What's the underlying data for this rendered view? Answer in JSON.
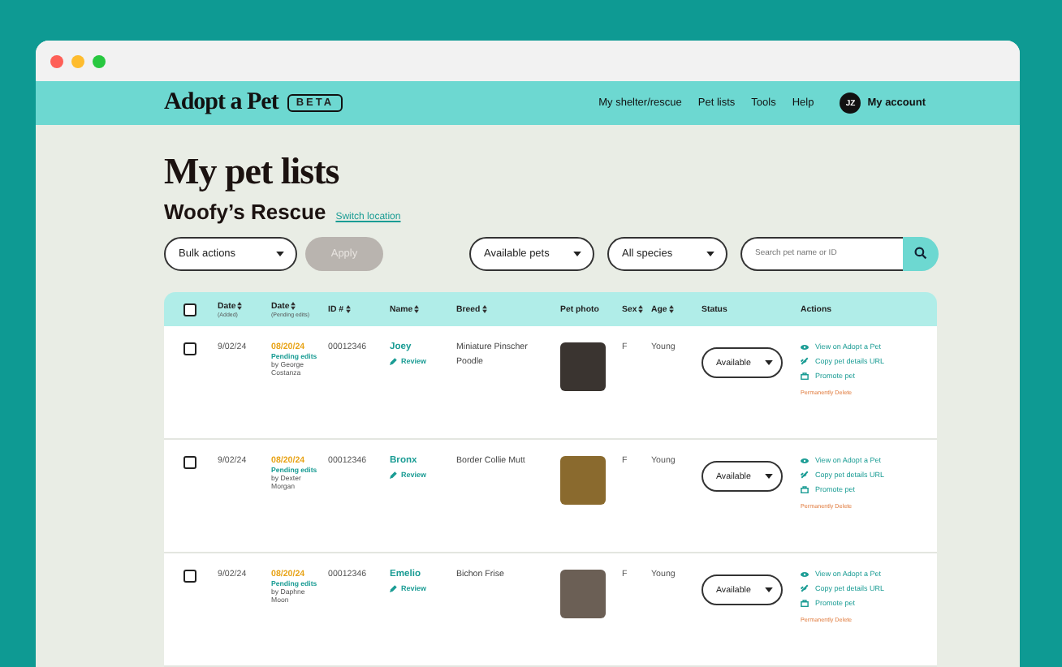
{
  "nav": {
    "logo": "Adopt a Pet",
    "badge": "BETA",
    "links": [
      "My shelter/rescue",
      "Pet lists",
      "Tools",
      "Help"
    ],
    "account": {
      "initials": "JZ",
      "label": "My account"
    }
  },
  "page": {
    "title": "My pet lists",
    "location": "Woofy’s Rescue",
    "switch_link": "Switch location"
  },
  "toolbar": {
    "bulk": "Bulk actions",
    "apply": {
      "label": "Apply",
      "disabled": true
    },
    "filters": [
      "Available pets",
      "All species"
    ],
    "search": {
      "placeholder": "Search pet name or ID"
    }
  },
  "table": {
    "header_checkbox": {
      "checked": false
    },
    "columns": [
      {
        "label": "Date",
        "sub": "(Added)",
        "sortable": true
      },
      {
        "label": "Date",
        "sub": "(Pending edits)",
        "sortable": true
      },
      {
        "label": "ID #",
        "sortable": true
      },
      {
        "label": "Name",
        "sortable": true
      },
      {
        "label": "Breed",
        "sortable": true
      },
      {
        "label": "Pet photo",
        "sortable": false
      },
      {
        "label": "Sex",
        "sortable": true
      },
      {
        "label": "Age",
        "sortable": true
      },
      {
        "label": "Status",
        "sortable": false
      },
      {
        "label": "Actions",
        "sortable": false
      }
    ],
    "rows": [
      {
        "checked": false,
        "added": "9/02/24",
        "pending_date": "08/20/24",
        "pending_label": "Pending edits",
        "editor": "by George Costanza",
        "id": "00012346",
        "name": "Joey",
        "review": "Review",
        "breed": "Miniature Pinscher Poodle",
        "sex": "F",
        "age": "Young",
        "status": "Available",
        "actions": [
          {
            "kind": "view",
            "label": "View on Adopt a Pet"
          },
          {
            "kind": "link",
            "label": "Copy pet details URL"
          },
          {
            "kind": "promote",
            "label": "Promote pet"
          }
        ],
        "delete": "Permanently Delete"
      },
      {
        "checked": false,
        "added": "9/02/24",
        "pending_date": "08/20/24",
        "pending_label": "Pending edits",
        "editor": "by Dexter Morgan",
        "id": "00012346",
        "name": "Bronx",
        "review": "Review",
        "breed": "Border Collie Mutt",
        "sex": "F",
        "age": "Young",
        "status": "Available",
        "actions": [
          {
            "kind": "view",
            "label": "View on Adopt a Pet"
          },
          {
            "kind": "link",
            "label": "Copy pet details URL"
          },
          {
            "kind": "promote",
            "label": "Promote pet"
          }
        ],
        "delete": "Permanently Delete"
      },
      {
        "checked": false,
        "added": "9/02/24",
        "pending_date": "08/20/24",
        "pending_label": "Pending edits",
        "editor": "by  Daphne Moon",
        "id": "00012346",
        "name": "Emelio",
        "review": "Review",
        "breed": "Bichon Frise",
        "sex": "F",
        "age": "Young",
        "status": "Available",
        "actions": [
          {
            "kind": "view",
            "label": "View on Adopt a Pet"
          },
          {
            "kind": "link",
            "label": "Copy pet details URL"
          },
          {
            "kind": "promote",
            "label": "Promote pet"
          }
        ],
        "delete": "Permanently Delete"
      }
    ]
  }
}
